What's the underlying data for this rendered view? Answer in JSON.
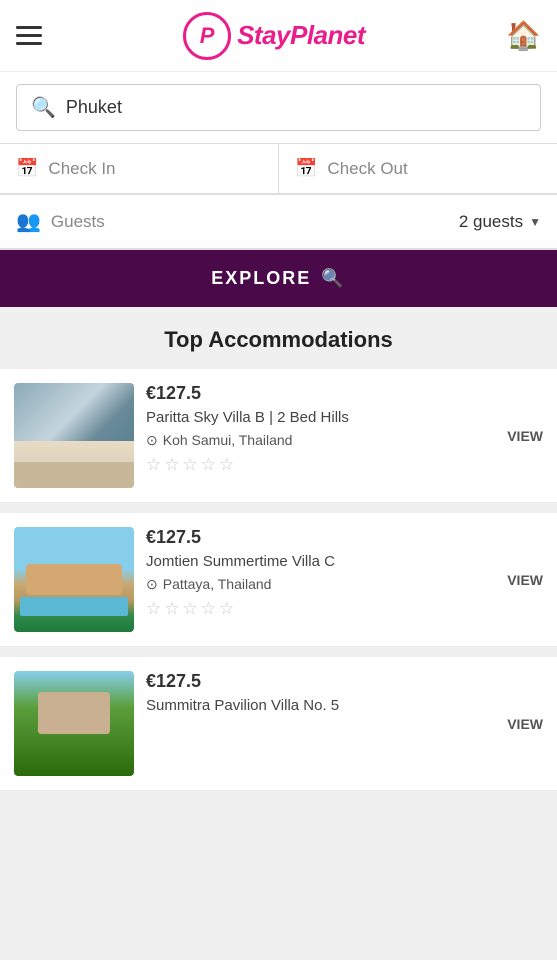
{
  "header": {
    "logo_text": "StayPlanet",
    "logo_p": "P",
    "home_icon": "🏠"
  },
  "search": {
    "placeholder": "Phuket",
    "value": "Phuket"
  },
  "checkin": {
    "label": "Check In",
    "icon": "📅"
  },
  "checkout": {
    "label": "Check Out",
    "icon": "📅"
  },
  "guests": {
    "label": "Guests",
    "value": "2 guests"
  },
  "explore_btn": "EXPLORE",
  "section_title": "Top Accommodations",
  "accommodations": [
    {
      "price": "€127.5",
      "name": "Paritta Sky Villa B | 2 Bed Hills",
      "location": "Koh Samui, Thailand",
      "view_label": "VIEW",
      "img_class": "img-bedroom"
    },
    {
      "price": "€127.5",
      "name": "Jomtien Summertime Villa C",
      "location": "Pattaya, Thailand",
      "view_label": "VIEW",
      "img_class": "img-villa"
    },
    {
      "price": "€127.5",
      "name": "Summitra Pavilion Villa No. 5",
      "location": "",
      "view_label": "VIEW",
      "img_class": "img-green"
    }
  ]
}
